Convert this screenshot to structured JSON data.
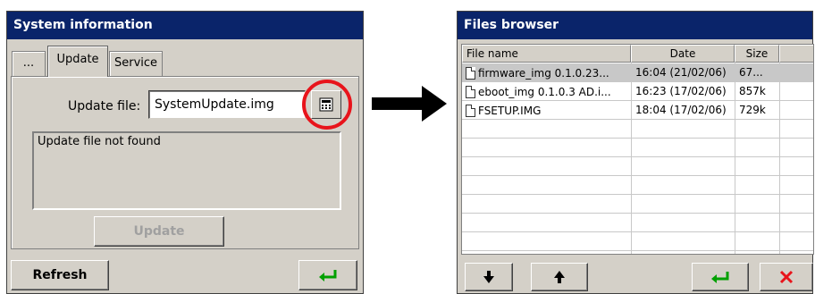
{
  "left_dialog": {
    "title": "System information",
    "tabs": [
      {
        "label": "..."
      },
      {
        "label": "Update"
      },
      {
        "label": "Service"
      }
    ],
    "update_file_label": "Update file:",
    "update_file_value": "SystemUpdate.img",
    "browse_icon": "calculator-icon",
    "message": "Update file not found",
    "update_button": "Update",
    "refresh_button": "Refresh",
    "enter_icon": "enter-arrow-icon",
    "highlight_color": "#e8141b"
  },
  "right_dialog": {
    "title": "Files browser",
    "columns": [
      "File name",
      "Date",
      "Size"
    ],
    "rows": [
      {
        "name": "firmware_img 0.1.0.23...",
        "date": "16:04 (21/02/06)",
        "size": "67..."
      },
      {
        "name": "eboot_img 0.1.0.3 AD.i...",
        "date": "16:23 (17/02/06)",
        "size": "857k"
      },
      {
        "name": "FSETUP.IMG",
        "date": "18:04 (17/02/06)",
        "size": "729k"
      }
    ],
    "buttons": {
      "down_icon": "arrow-down-icon",
      "up_icon": "arrow-up-icon",
      "enter_icon": "enter-arrow-icon",
      "cancel_icon": "close-icon"
    },
    "title_color": "#0a246a",
    "cancel_color": "#e8141b",
    "enter_color": "#00a000"
  }
}
